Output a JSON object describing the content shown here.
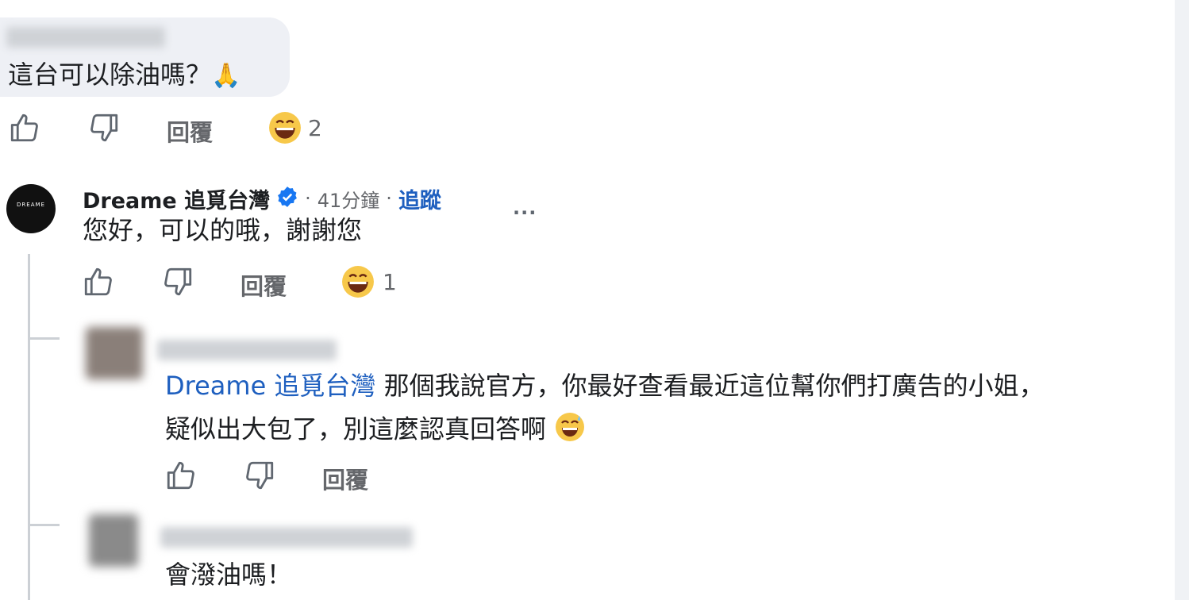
{
  "comment1": {
    "text": "這台可以除油嗎？",
    "emoji": "🙏",
    "actions": {
      "reply": "回覆",
      "reaction_count": "2"
    }
  },
  "comment2": {
    "author": "Dreame 追覓台灣",
    "separator1": "·",
    "time": "41分鐘",
    "separator2": "·",
    "follow": "追蹤",
    "more": "···",
    "text": "您好，可以的哦，謝謝您",
    "actions": {
      "reply": "回覆",
      "reaction_count": "1"
    },
    "avatar_text": "DREAME"
  },
  "comment3": {
    "mention": "Dreame 追覓台灣",
    "line1": " 那個我說官方，你最好查看最近這位幫你們打廣告的小姐，",
    "line2": "疑似出大包了，別這麼認真回答啊",
    "actions": {
      "reply": "回覆"
    }
  },
  "comment4": {
    "text": "會潑油嗎！"
  },
  "colors": {
    "link": "#1e5fbf",
    "muted": "#65676b",
    "bubble": "#eef0f5"
  }
}
